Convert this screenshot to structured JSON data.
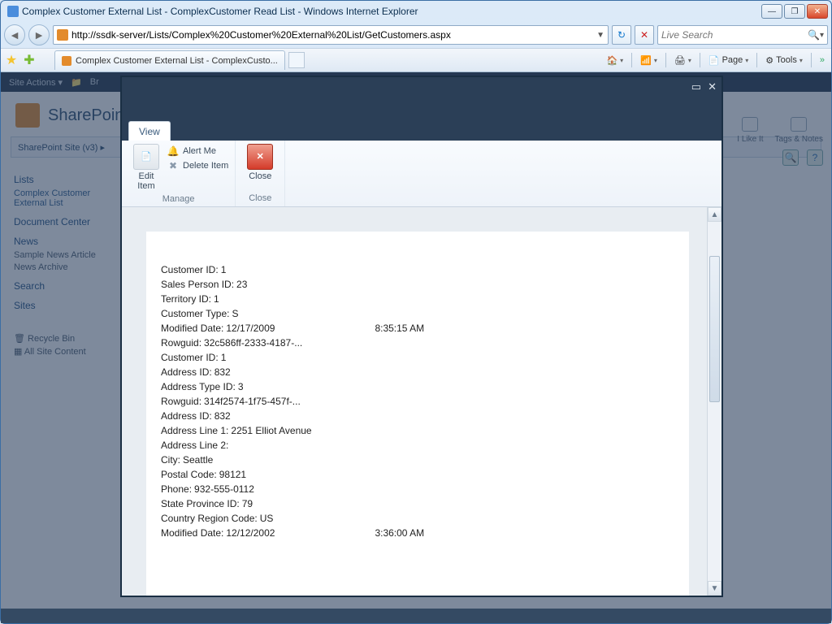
{
  "window": {
    "title": "Complex Customer External List - ComplexCustomer Read List - Windows Internet Explorer"
  },
  "nav": {
    "url": "http://ssdk-server/Lists/Complex%20Customer%20External%20List/GetCustomers.aspx",
    "search_placeholder": "Live Search"
  },
  "tab": {
    "label": "Complex Customer External List - ComplexCusto..."
  },
  "toolbar": {
    "page": "Page",
    "tools": "Tools"
  },
  "sharepoint": {
    "site_actions": "Site Actions",
    "browse_hint": "Br",
    "brand": "SharePoint",
    "breadcrumb": "SharePoint Site (v3)  ▸",
    "ilike": "I Like It",
    "tags": "Tags & Notes",
    "side": {
      "lists": "Lists",
      "ext_list": "Complex Customer External List",
      "doc_center": "Document Center",
      "news": "News",
      "sample": "Sample News Article",
      "archive": "News Archive",
      "search": "Search",
      "sites": "Sites",
      "recycle": "Recycle Bin",
      "all": "All Site Content"
    }
  },
  "modal": {
    "tab_view": "View",
    "ribbon": {
      "edit_item": "Edit Item",
      "alert_me": "Alert Me",
      "delete_item": "Delete Item",
      "manage": "Manage",
      "close": "Close",
      "close_group": "Close"
    },
    "fields": [
      {
        "k": "Customer ID:",
        "v": "1"
      },
      {
        "k": "Sales Person ID:",
        "v": "23"
      },
      {
        "k": "Territory ID:",
        "v": "1"
      },
      {
        "k": "Customer Type:",
        "v": "S"
      },
      {
        "k": "Modified Date:",
        "v": "12/17/2009",
        "v2": "8:35:15 AM"
      },
      {
        "k": "Rowguid:",
        "v": "32c586ff-2333-4187-..."
      },
      {
        "k": "Customer ID:",
        "v": "1"
      },
      {
        "k": "Address ID:",
        "v": "832"
      },
      {
        "k": "Address Type ID:",
        "v": "3"
      },
      {
        "k": "Rowguid:",
        "v": "314f2574-1f75-457f-..."
      },
      {
        "k": "Address ID:",
        "v": "832"
      },
      {
        "k": "Address Line 1:",
        "v": "2251 Elliot Avenue"
      },
      {
        "k": "Address Line 2:",
        "v": ""
      },
      {
        "k": "City:",
        "v": "Seattle"
      },
      {
        "k": "Postal Code:",
        "v": "98121"
      },
      {
        "k": "Phone:",
        "v": "932-555-0112"
      },
      {
        "k": "State Province ID:",
        "v": "79"
      },
      {
        "k": "Country Region Code:",
        "v": "US"
      },
      {
        "k": "Modified Date:",
        "v": "12/12/2002",
        "v2": "3:36:00 AM"
      }
    ]
  }
}
